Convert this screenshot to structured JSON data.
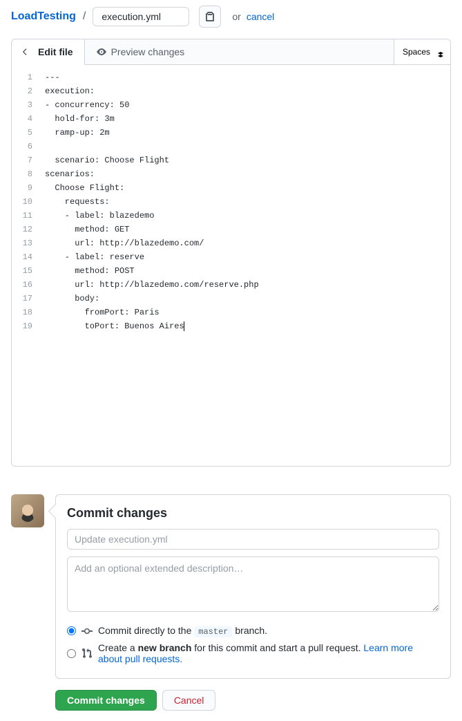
{
  "header": {
    "repo_name": "LoadTesting",
    "separator": "/",
    "filename": "execution.yml",
    "or_text": "or",
    "cancel_text": "cancel"
  },
  "tabs": {
    "edit_label": "Edit file",
    "preview_label": "Preview changes",
    "indent_mode": "Spaces"
  },
  "code": {
    "lines": [
      "---",
      "execution:",
      "- concurrency: 50",
      "  hold-for: 3m",
      "  ramp-up: 2m",
      "",
      "  scenario: Choose Flight",
      "scenarios:",
      "  Choose Flight:",
      "    requests:",
      "    - label: blazedemo",
      "      method: GET",
      "      url: http://blazedemo.com/",
      "    - label: reserve",
      "      method: POST",
      "      url: http://blazedemo.com/reserve.php",
      "      body:",
      "        fromPort: Paris",
      "        toPort: Buenos Aires"
    ]
  },
  "commit": {
    "heading": "Commit changes",
    "summary_placeholder": "Update execution.yml",
    "description_placeholder": "Add an optional extended description…",
    "radio_direct_prefix": "Commit directly to the",
    "radio_direct_branch": "master",
    "radio_direct_suffix": "branch.",
    "radio_new_prefix": "Create a",
    "radio_new_bold": "new branch",
    "radio_new_suffix": "for this commit and start a pull request.",
    "learn_more": "Learn more about pull requests.",
    "commit_btn": "Commit changes",
    "cancel_btn": "Cancel"
  }
}
